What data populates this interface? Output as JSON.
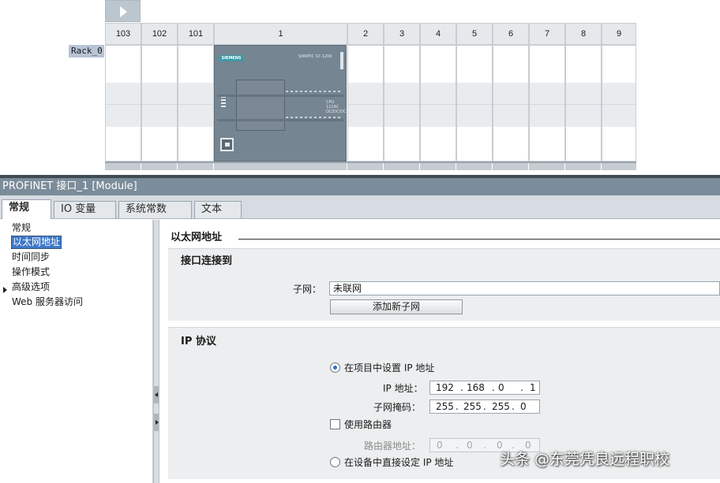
{
  "rack": {
    "name": "Rack_0",
    "slots": [
      "103",
      "102",
      "101",
      "1",
      "2",
      "3",
      "4",
      "5",
      "6",
      "7",
      "8",
      "9"
    ],
    "cpu": {
      "brand": "SIEMENS",
      "model": "SIMATIC S7-1200",
      "cpu_text": "CPU 1214C",
      "cpu_text2": "DC/DC/DC"
    }
  },
  "inspector": {
    "title": "PROFINET 接口_1 [Module]",
    "tabs": [
      "常规",
      "IO 变量",
      "系统常数",
      "文本"
    ],
    "nav": [
      "常规",
      "以太网地址",
      "时间同步",
      "操作模式",
      "高级选项",
      "Web 服务器访问"
    ],
    "nav_selected_index": 1
  },
  "ethernet": {
    "section_title": "以太网地址",
    "interface_group": {
      "title": "接口连接到",
      "subnet_label": "子网：",
      "subnet_value": "未联网",
      "add_subnet_button": "添加新子网"
    },
    "ip_group": {
      "title": "IP 协议",
      "option_project": "在项目中设置 IP 地址",
      "ip_label": "IP 地址：",
      "ip": [
        "192",
        "168",
        "0",
        "1"
      ],
      "mask_label": "子网掩码：",
      "mask": [
        "255",
        "255",
        "255",
        "0"
      ],
      "use_router_label": "使用路由器",
      "router_label": "路由器地址：",
      "router": [
        "0",
        "0",
        "0",
        "0"
      ],
      "option_device": "在设备中直接设定 IP 地址"
    }
  },
  "watermark": "头条 @东莞凭良远程职校"
}
